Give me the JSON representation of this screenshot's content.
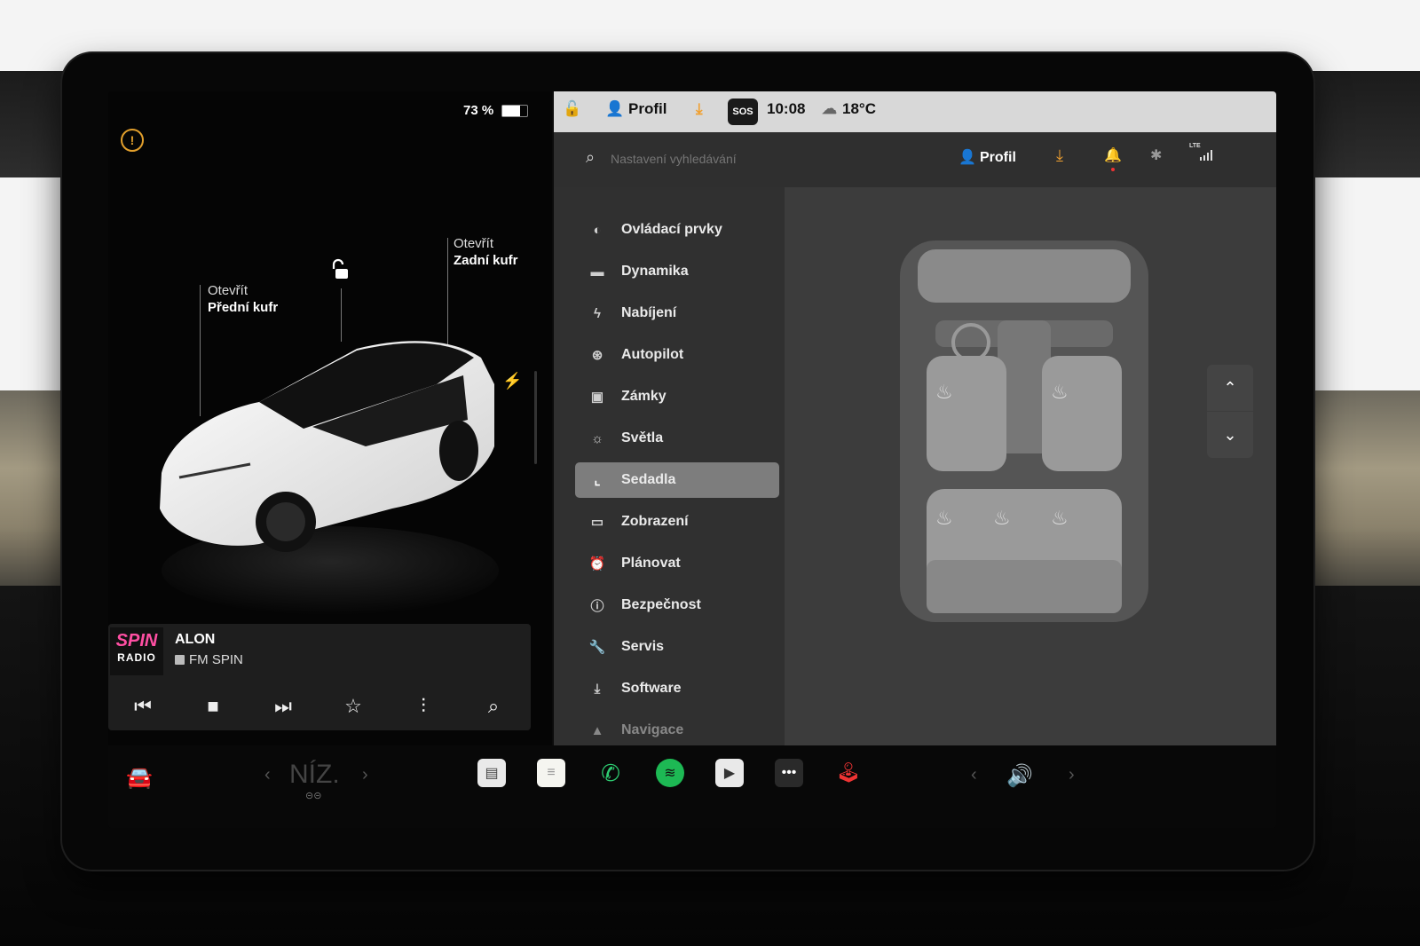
{
  "status": {
    "battery": "73 %",
    "profile": "Profil",
    "sos": "SOS",
    "time": "10:08",
    "temp": "18°C"
  },
  "search": {
    "placeholder": "Nastavení vyhledávání",
    "profile": "Profil",
    "lte": "LTE"
  },
  "car": {
    "front_trunk_action": "Otevřít",
    "front_trunk_label": "Přední kufr",
    "rear_trunk_action": "Otevřít",
    "rear_trunk_label": "Zadní kufr"
  },
  "media": {
    "logo_line1": "SPIN",
    "logo_line2": "RADIO",
    "title": "ALON",
    "station": "FM SPIN"
  },
  "menu": {
    "items": [
      {
        "label": "Ovládací prvky",
        "icon": "toggle-icon"
      },
      {
        "label": "Dynamika",
        "icon": "car-icon"
      },
      {
        "label": "Nabíjení",
        "icon": "bolt-icon"
      },
      {
        "label": "Autopilot",
        "icon": "steering-wheel-icon"
      },
      {
        "label": "Zámky",
        "icon": "lock-icon"
      },
      {
        "label": "Světla",
        "icon": "sun-icon"
      },
      {
        "label": "Sedadla",
        "icon": "seat-icon",
        "active": true
      },
      {
        "label": "Zobrazení",
        "icon": "display-icon"
      },
      {
        "label": "Plánovat",
        "icon": "alarm-icon"
      },
      {
        "label": "Bezpečnost",
        "icon": "info-icon"
      },
      {
        "label": "Servis",
        "icon": "wrench-icon"
      },
      {
        "label": "Software",
        "icon": "download-icon"
      },
      {
        "label": "Navigace",
        "icon": "navigation-icon"
      }
    ]
  },
  "bottom": {
    "climate": "NÍZ."
  },
  "colors": {
    "accent_orange": "#f0a030",
    "active_menu": "#7d7d7d",
    "spotify_green": "#1db954",
    "phone_green": "#2ecc71"
  }
}
